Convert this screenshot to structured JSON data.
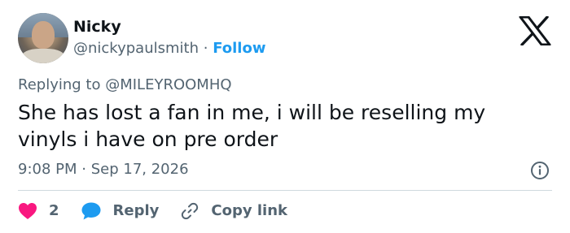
{
  "author": {
    "name": "Nicky",
    "handle": "@nickypaulsmith",
    "separator": "·",
    "follow_label": "Follow"
  },
  "tweet": {
    "replying_prefix": "Replying to",
    "replying_to": "@MILEYROOMHQ",
    "text": "She has lost a fan in me, i will be reselling my vinyls i have on pre order",
    "time": "9:08 PM",
    "date": "Sep 17, 2026"
  },
  "actions": {
    "like_count": "2",
    "reply_label": "Reply",
    "copy_link_label": "Copy link"
  },
  "icons": {
    "logo": "x-logo-icon",
    "info": "info-icon",
    "like": "heart-icon",
    "reply": "speech-bubble-icon",
    "copy_link": "link-icon"
  },
  "colors": {
    "accent": "#1d9bf0",
    "like": "#f91880",
    "muted": "#536471",
    "text": "#0f1419"
  }
}
